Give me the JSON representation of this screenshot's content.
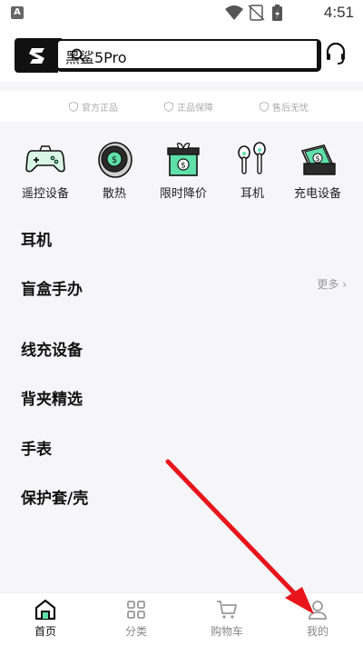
{
  "statusbar": {
    "app_badge": "A",
    "time": "4:51"
  },
  "header": {
    "search_value": "黑鲨5Pro",
    "icons": [
      "blackshark-logo-icon",
      "search-icon",
      "headset-icon"
    ]
  },
  "guarantee": {
    "items": [
      "官方正品",
      "正品保障",
      "售后无忧"
    ]
  },
  "categories": [
    {
      "label": "遥控设备",
      "icon": "gamepad-icon"
    },
    {
      "label": "散热",
      "icon": "cooler-fan-icon"
    },
    {
      "label": "限时降价",
      "icon": "gift-box-icon"
    },
    {
      "label": "耳机",
      "icon": "earbuds-icon"
    },
    {
      "label": "充电设备",
      "icon": "charger-icon"
    }
  ],
  "sections": [
    {
      "title": "耳机"
    },
    {
      "title": "盲盒手办",
      "more": "更多 ›"
    },
    {
      "title": "线充设备"
    },
    {
      "title": "背夹精选"
    },
    {
      "title": "手表"
    },
    {
      "title": "保护套/壳"
    }
  ],
  "bottom_nav": [
    {
      "label": "首页",
      "icon": "home-icon",
      "active": true
    },
    {
      "label": "分类",
      "icon": "grid-icon",
      "active": false
    },
    {
      "label": "购物车",
      "icon": "cart-icon",
      "active": false
    },
    {
      "label": "我的",
      "icon": "profile-icon",
      "active": false
    }
  ],
  "colors": {
    "accent_green": "#5fe0a8",
    "annotation_red": "#e8141b"
  }
}
